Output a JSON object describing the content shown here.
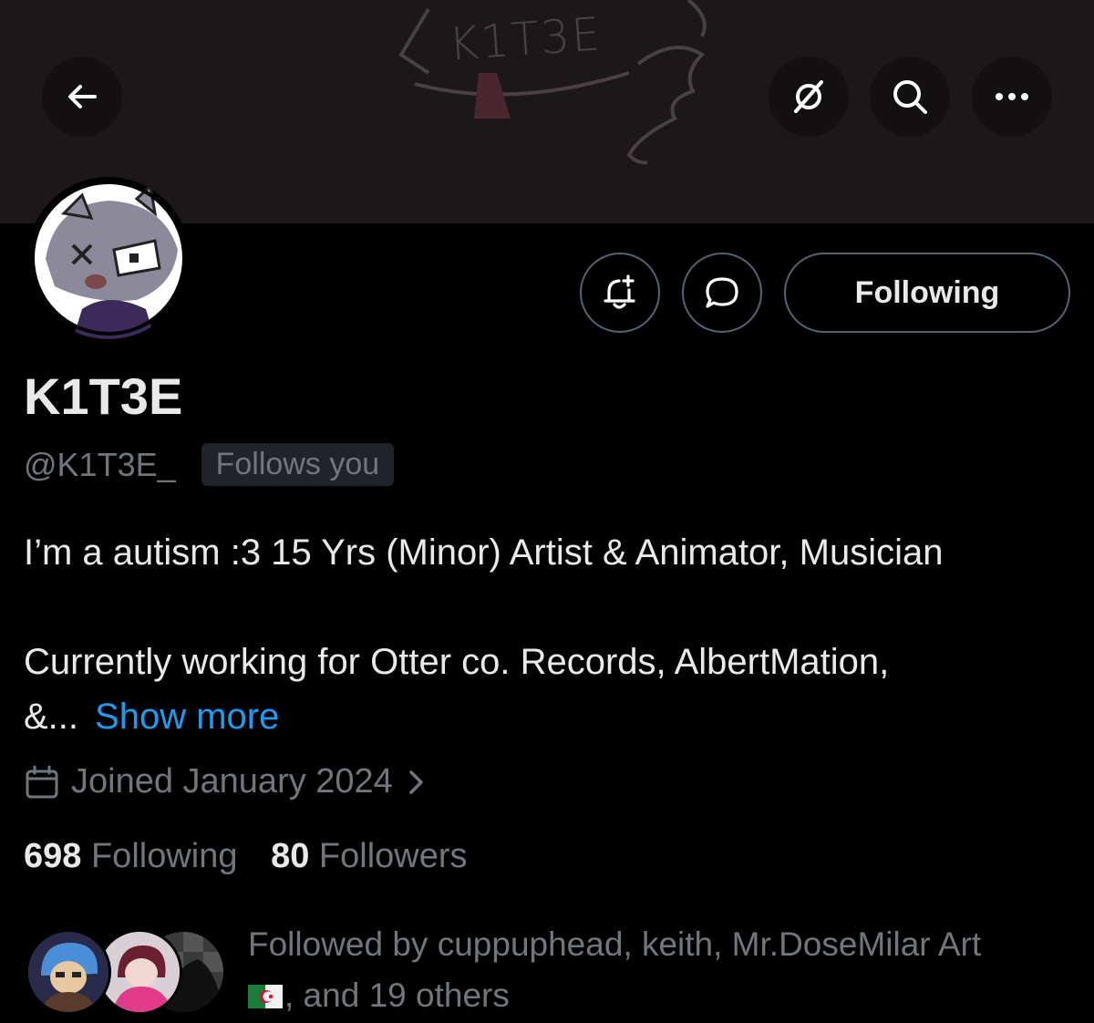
{
  "banner": {
    "art_text": "K1T3E"
  },
  "header": {
    "back_icon": "arrow-left-icon",
    "grok_icon": "grok-icon",
    "search_icon": "search-icon",
    "more_icon": "more-horizontal-icon"
  },
  "actions": {
    "notify_icon": "bell-plus-icon",
    "message_icon": "message-bubble-icon",
    "follow_label": "Following"
  },
  "profile": {
    "name": "K1T3E",
    "handle": "@K1T3E_",
    "follows_you": "Follows you",
    "bio_line1": "I’m a autism :3 15 Yrs (Minor) Artist & Animator, Musician",
    "bio_line2": "Currently working for Otter co. Records, AlbertMation,",
    "bio_line3": "&...",
    "show_more": "Show more",
    "joined": "Joined January 2024"
  },
  "stats": {
    "following_count": "698",
    "following_label": "Following",
    "followers_count": "80",
    "followers_label": "Followers"
  },
  "followed_by": {
    "text_line1": "Followed by cuppuphead, keith, Mr.DoseMilar Art",
    "text_line2": ", and 19 others"
  },
  "colors": {
    "background": "#000000",
    "banner": "#1c1819",
    "link": "#1d9bf0",
    "muted": "#71767b",
    "text": "#e7e9ea",
    "border": "#536471"
  }
}
